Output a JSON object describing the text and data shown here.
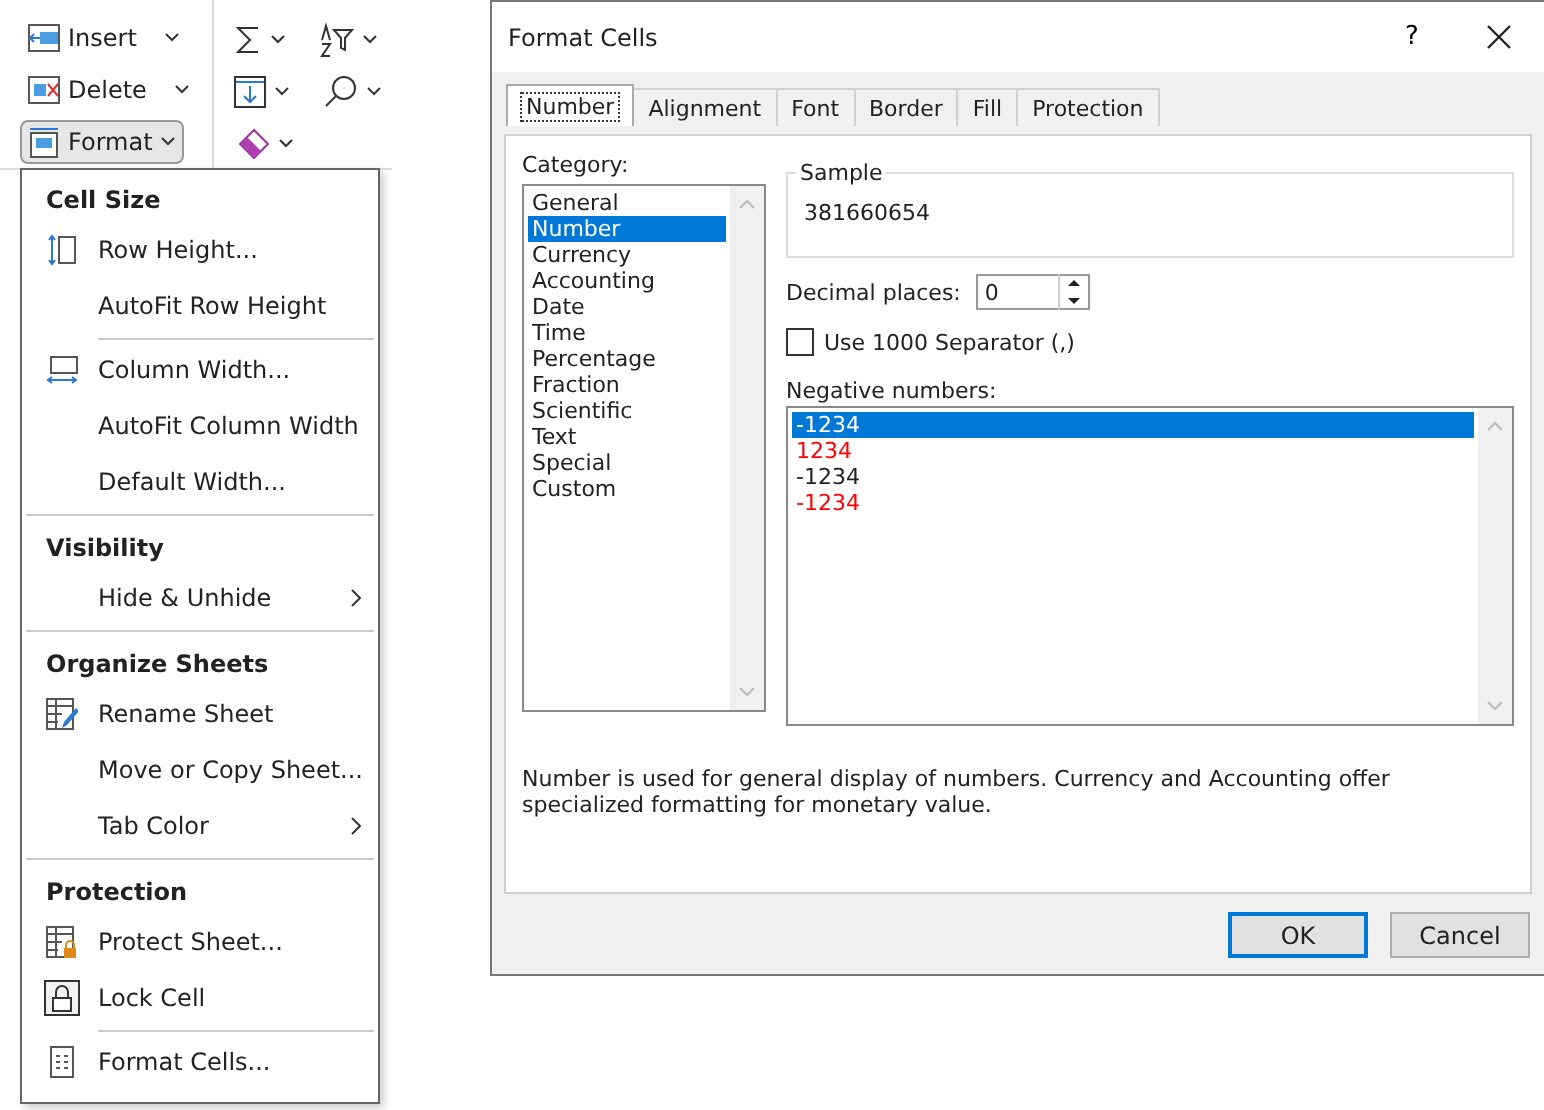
{
  "ribbon": {
    "cells_buttons": [
      {
        "kind": "insert",
        "label": "Insert",
        "pressed": false
      },
      {
        "kind": "delete",
        "label": "Delete",
        "pressed": false
      },
      {
        "kind": "format",
        "label": "Format",
        "pressed": true
      }
    ]
  },
  "format_menu": {
    "sections": [
      {
        "header": "Cell Size",
        "items": [
          {
            "kind": "row-height",
            "label": "Row Height...",
            "submenu": false,
            "separator_before": false
          },
          {
            "kind": "none",
            "label": "AutoFit Row Height",
            "submenu": false,
            "separator_before": false
          },
          {
            "kind": "column-width",
            "label": "Column Width...",
            "submenu": false,
            "separator_before": true
          },
          {
            "kind": "none",
            "label": "AutoFit Column Width",
            "submenu": false,
            "separator_before": false
          },
          {
            "kind": "none",
            "label": "Default Width...",
            "submenu": false,
            "separator_before": false
          }
        ]
      },
      {
        "header": "Visibility",
        "items": [
          {
            "kind": "none",
            "label": "Hide & Unhide",
            "submenu": true,
            "separator_before": false
          }
        ]
      },
      {
        "header": "Organize Sheets",
        "items": [
          {
            "kind": "rename",
            "label": "Rename Sheet",
            "submenu": false,
            "separator_before": false
          },
          {
            "kind": "none",
            "label": "Move or Copy Sheet...",
            "submenu": false,
            "separator_before": false
          },
          {
            "kind": "none",
            "label": "Tab Color",
            "submenu": true,
            "separator_before": false
          }
        ]
      },
      {
        "header": "Protection",
        "items": [
          {
            "kind": "protect",
            "label": "Protect Sheet...",
            "submenu": false,
            "separator_before": false
          },
          {
            "kind": "lock",
            "label": "Lock Cell",
            "submenu": false,
            "separator_before": false
          },
          {
            "kind": "format-cells",
            "label": "Format Cells...",
            "submenu": false,
            "separator_before": true
          }
        ]
      }
    ]
  },
  "dialog": {
    "title": "Format Cells",
    "help": "?",
    "tabs": [
      {
        "label": "Number",
        "selected": true
      },
      {
        "label": "Alignment",
        "selected": false
      },
      {
        "label": "Font",
        "selected": false
      },
      {
        "label": "Border",
        "selected": false
      },
      {
        "label": "Fill",
        "selected": false
      },
      {
        "label": "Protection",
        "selected": false
      }
    ],
    "category_label": "Category:",
    "categories": [
      {
        "label": "General",
        "selected": false
      },
      {
        "label": "Number",
        "selected": true
      },
      {
        "label": "Currency",
        "selected": false
      },
      {
        "label": "Accounting",
        "selected": false
      },
      {
        "label": "Date",
        "selected": false
      },
      {
        "label": "Time",
        "selected": false
      },
      {
        "label": "Percentage",
        "selected": false
      },
      {
        "label": "Fraction",
        "selected": false
      },
      {
        "label": "Scientific",
        "selected": false
      },
      {
        "label": "Text",
        "selected": false
      },
      {
        "label": "Special",
        "selected": false
      },
      {
        "label": "Custom",
        "selected": false
      }
    ],
    "sample_label": "Sample",
    "sample_value": "381660654",
    "decimal_label": "Decimal places:",
    "decimal_value": "0",
    "separator_checkbox": {
      "label": "Use 1000 Separator (,)",
      "checked": false
    },
    "negative_label": "Negative numbers:",
    "negative_numbers": [
      {
        "label": "-1234",
        "red": false,
        "selected": true
      },
      {
        "label": "1234",
        "red": true,
        "selected": false
      },
      {
        "label": "-1234",
        "red": false,
        "selected": false
      },
      {
        "label": "-1234",
        "red": true,
        "selected": false
      }
    ],
    "description": "Number is used for general display of numbers.  Currency and Accounting offer specialized formatting for monetary value.",
    "buttons": [
      {
        "label": "OK",
        "default": true
      },
      {
        "label": "Cancel",
        "default": false
      }
    ]
  }
}
